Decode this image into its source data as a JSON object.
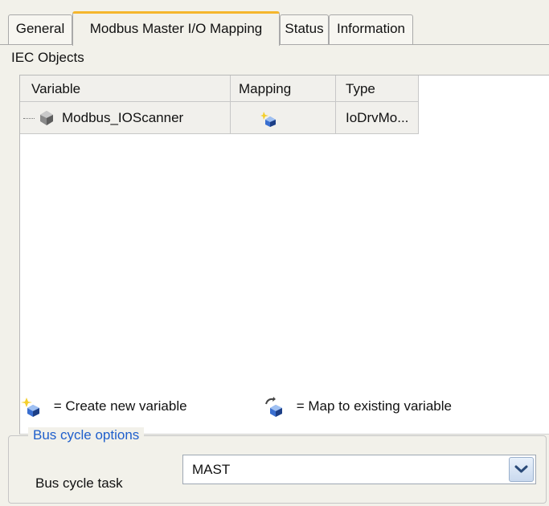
{
  "tabs": [
    {
      "label": "General"
    },
    {
      "label": "Modbus Master I/O Mapping",
      "active": true
    },
    {
      "label": "Status"
    },
    {
      "label": "Information"
    }
  ],
  "iec_objects": {
    "title": "IEC Objects",
    "columns": [
      "Variable",
      "Mapping",
      "Type"
    ],
    "rows": [
      {
        "variable": "Modbus_IOScanner",
        "mapping_icon": "create-new-variable-icon",
        "type": "IoDrvMo..."
      }
    ]
  },
  "legend": {
    "create": {
      "icon": "create-new-variable-icon",
      "text": "= Create new variable"
    },
    "map": {
      "icon": "map-existing-variable-icon",
      "text": "= Map to existing variable"
    }
  },
  "bus_cycle": {
    "group_title": "Bus cycle options",
    "task_label": "Bus cycle task",
    "task_value": "MAST"
  },
  "colors": {
    "active_tab_accent": "#f5b62c",
    "group_title": "#1f5fcc",
    "background": "#f2f1ea"
  }
}
